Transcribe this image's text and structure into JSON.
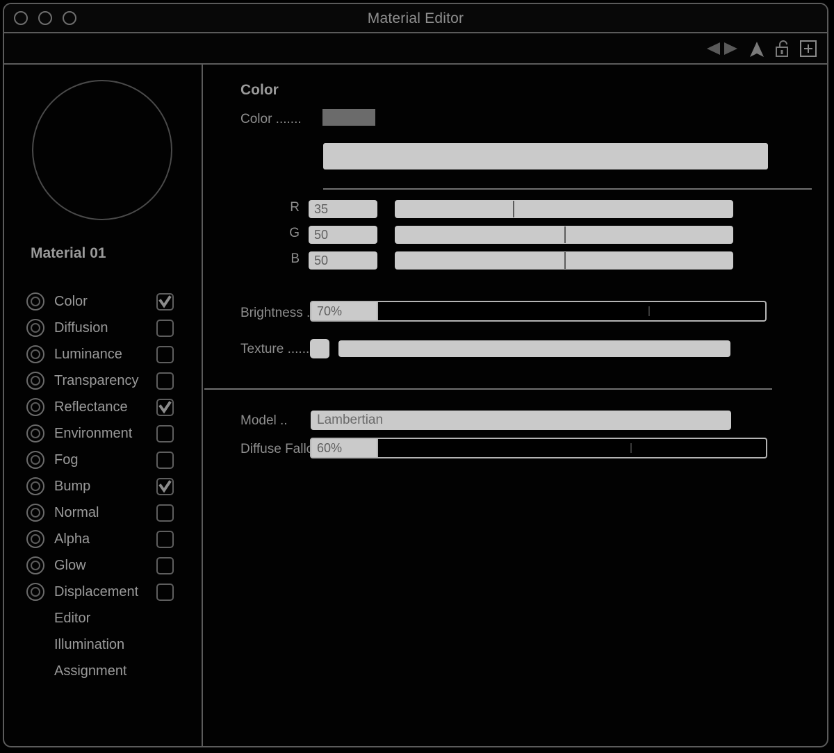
{
  "window": {
    "title": "Material Editor",
    "traffic_lights": [
      "close-button",
      "minimize-button",
      "zoom-button"
    ]
  },
  "toolbar": {
    "icons": [
      {
        "name": "previous-arrow-icon",
        "glyph": "left-triangle"
      },
      {
        "name": "next-arrow-icon",
        "glyph": "right-triangle"
      },
      {
        "name": "up-arrow-icon",
        "glyph": "up-triangle"
      },
      {
        "name": "lock-icon",
        "glyph": "open-padlock"
      },
      {
        "name": "add-icon",
        "glyph": "plus-in-box"
      }
    ]
  },
  "sidebar": {
    "preview": {
      "shape": "sphere-outline",
      "material_name": "Material 01"
    },
    "channels": [
      {
        "label": "Color",
        "checked": true,
        "has_controls": true
      },
      {
        "label": "Diffusion",
        "checked": false,
        "has_controls": true
      },
      {
        "label": "Luminance",
        "checked": false,
        "has_controls": true
      },
      {
        "label": "Transparency",
        "checked": false,
        "has_controls": true
      },
      {
        "label": "Reflectance",
        "checked": true,
        "has_controls": true
      },
      {
        "label": "Environment",
        "checked": false,
        "has_controls": true
      },
      {
        "label": "Fog",
        "checked": false,
        "has_controls": true
      },
      {
        "label": "Bump",
        "checked": true,
        "has_controls": true
      },
      {
        "label": "Normal",
        "checked": false,
        "has_controls": true
      },
      {
        "label": "Alpha",
        "checked": false,
        "has_controls": true
      },
      {
        "label": "Glow",
        "checked": false,
        "has_controls": true
      },
      {
        "label": "Displacement",
        "checked": false,
        "has_controls": true
      },
      {
        "label": "Editor",
        "checked": false,
        "has_controls": false
      },
      {
        "label": "Illumination",
        "checked": false,
        "has_controls": false
      },
      {
        "label": "Assignment",
        "checked": false,
        "has_controls": false
      }
    ]
  },
  "content": {
    "section_title": "Color",
    "color_row": {
      "label": "Color .......",
      "swatch_hex": "#6b6b6b"
    },
    "rgb": [
      {
        "letter": "R",
        "value": "35",
        "percent": 35
      },
      {
        "letter": "G",
        "value": "50",
        "percent": 50
      },
      {
        "letter": "B",
        "value": "50",
        "percent": 50
      }
    ],
    "brightness": {
      "label": "Brightness ..",
      "value": "70%",
      "percent": 70
    },
    "texture": {
      "label": "Texture .......",
      "value": ""
    },
    "model": {
      "label": "Model ..",
      "value": "Lambertian"
    },
    "diffuse_falloff": {
      "label": "Diffuse Fallof",
      "value": "60%",
      "percent": 60
    }
  }
}
